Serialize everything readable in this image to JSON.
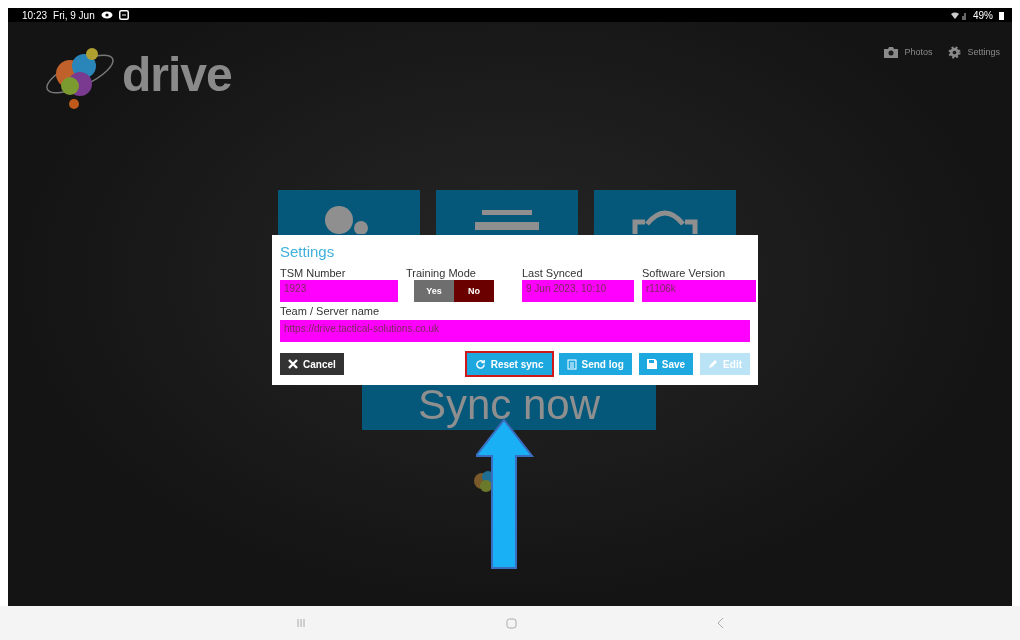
{
  "status_bar": {
    "time": "10:23",
    "date": "Fri, 9 Jun",
    "battery": "49%"
  },
  "app": {
    "logo_text": "drive",
    "actions": [
      {
        "label": "Photos",
        "kind": "camera"
      },
      {
        "label": "Settings",
        "kind": "gear"
      }
    ],
    "tiles": [
      {
        "kind": "person"
      },
      {
        "kind": "list"
      },
      {
        "kind": "vehicle"
      }
    ],
    "sync_button": {
      "label": "Sync now"
    }
  },
  "dialog": {
    "title": "Settings",
    "fields": [
      {
        "kind": "text",
        "label": "TSM Number",
        "value": "1923"
      },
      {
        "kind": "toggle",
        "label": "Training Mode",
        "options": [
          {
            "label": "Yes",
            "selected": false
          },
          {
            "label": "No",
            "selected": true
          }
        ]
      },
      {
        "kind": "text",
        "label": "Last Synced",
        "value": "9 Jun 2023, 10:10"
      },
      {
        "kind": "text",
        "label": "Software Version",
        "value": "r1106k"
      }
    ],
    "server": {
      "label": "Team / Server name",
      "value": "https://drive.tactical-solutions.co.uk"
    },
    "buttons": [
      {
        "kind": "cancel",
        "label": "Cancel",
        "disabled": false,
        "highlighted": false
      },
      {
        "kind": "reset",
        "label": "Reset sync",
        "disabled": false,
        "highlighted": true
      },
      {
        "kind": "log",
        "label": "Send log",
        "disabled": false,
        "highlighted": false
      },
      {
        "kind": "save",
        "label": "Save",
        "disabled": false,
        "highlighted": false
      },
      {
        "kind": "edit",
        "label": "Edit",
        "disabled": true,
        "highlighted": false
      }
    ]
  },
  "annotation": {
    "kind": "arrow-up"
  }
}
